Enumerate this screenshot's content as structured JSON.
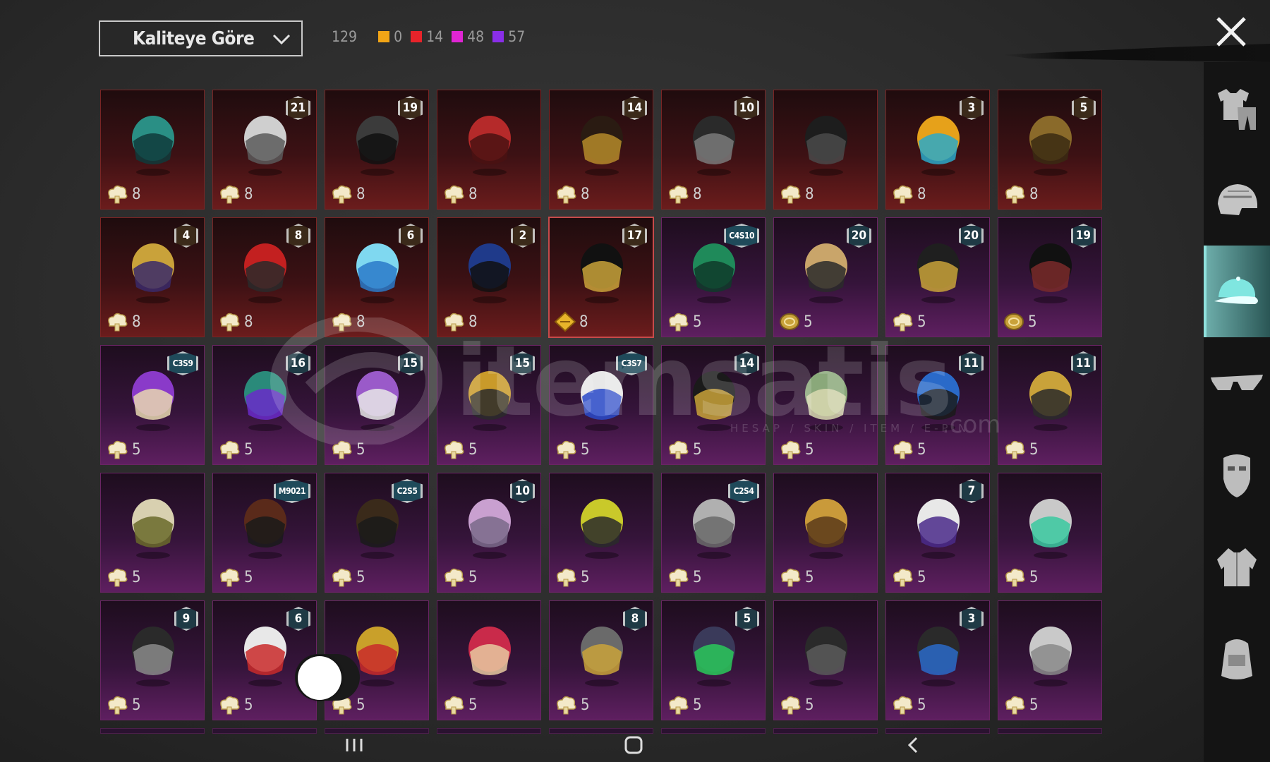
{
  "header": {
    "sort_label": "Kaliteye Göre",
    "total_count": "129",
    "rarity_counts": [
      {
        "color": "#f2a516",
        "count": "0"
      },
      {
        "color": "#e8232a",
        "count": "14"
      },
      {
        "color": "#e025d4",
        "count": "48"
      },
      {
        "color": "#8a2ee8",
        "count": "57"
      }
    ]
  },
  "sidebar": {
    "items": [
      {
        "icon": "shirt-pants-icon"
      },
      {
        "icon": "helmet-icon"
      },
      {
        "icon": "cap-icon",
        "active": true
      },
      {
        "icon": "glasses-icon"
      },
      {
        "icon": "mask-icon"
      },
      {
        "icon": "jacket-icon"
      },
      {
        "icon": "backpack-icon"
      }
    ]
  },
  "items": [
    {
      "tier": "red",
      "badge": "",
      "cost": "8",
      "currency": "cloud"
    },
    {
      "tier": "red",
      "badge": "21",
      "cost": "8",
      "currency": "cloud"
    },
    {
      "tier": "red",
      "badge": "19",
      "cost": "8",
      "currency": "cloud"
    },
    {
      "tier": "red",
      "badge": "",
      "cost": "8",
      "currency": "cloud"
    },
    {
      "tier": "red",
      "badge": "14",
      "cost": "8",
      "currency": "cloud"
    },
    {
      "tier": "red",
      "badge": "10",
      "cost": "8",
      "currency": "cloud"
    },
    {
      "tier": "red",
      "badge": "",
      "cost": "8",
      "currency": "cloud"
    },
    {
      "tier": "red",
      "badge": "3",
      "cost": "8",
      "currency": "cloud"
    },
    {
      "tier": "red",
      "badge": "5",
      "cost": "8",
      "currency": "cloud"
    },
    {
      "tier": "red",
      "badge": "4",
      "cost": "8",
      "currency": "cloud"
    },
    {
      "tier": "red",
      "badge": "8",
      "cost": "8",
      "currency": "cloud"
    },
    {
      "tier": "red",
      "badge": "6",
      "cost": "8",
      "currency": "cloud"
    },
    {
      "tier": "red",
      "badge": "2",
      "cost": "8",
      "currency": "cloud"
    },
    {
      "tier": "red",
      "badge": "17",
      "cost": "8",
      "currency": "diamond",
      "selected": true
    },
    {
      "tier": "purple",
      "badge": "C4S10",
      "cost": "5",
      "currency": "cloud"
    },
    {
      "tier": "purple",
      "badge": "20",
      "cost": "5",
      "currency": "coin"
    },
    {
      "tier": "purple",
      "badge": "20",
      "cost": "5",
      "currency": "cloud"
    },
    {
      "tier": "purple",
      "badge": "19",
      "cost": "5",
      "currency": "coin"
    },
    {
      "tier": "purple",
      "badge": "C3S9",
      "cost": "5",
      "currency": "cloud"
    },
    {
      "tier": "purple",
      "badge": "16",
      "cost": "5",
      "currency": "cloud"
    },
    {
      "tier": "purple",
      "badge": "15",
      "cost": "5",
      "currency": "cloud"
    },
    {
      "tier": "purple",
      "badge": "15",
      "cost": "5",
      "currency": "cloud"
    },
    {
      "tier": "purple",
      "badge": "C3S7",
      "cost": "5",
      "currency": "cloud"
    },
    {
      "tier": "purple",
      "badge": "14",
      "cost": "5",
      "currency": "cloud"
    },
    {
      "tier": "purple",
      "badge": "",
      "cost": "5",
      "currency": "cloud"
    },
    {
      "tier": "purple",
      "badge": "11",
      "cost": "5",
      "currency": "cloud"
    },
    {
      "tier": "purple",
      "badge": "11",
      "cost": "5",
      "currency": "cloud"
    },
    {
      "tier": "purple",
      "badge": "",
      "cost": "5",
      "currency": "cloud"
    },
    {
      "tier": "purple",
      "badge": "M9021",
      "cost": "5",
      "currency": "cloud"
    },
    {
      "tier": "purple",
      "badge": "C2S5",
      "cost": "5",
      "currency": "cloud"
    },
    {
      "tier": "purple",
      "badge": "10",
      "cost": "5",
      "currency": "cloud"
    },
    {
      "tier": "purple",
      "badge": "",
      "cost": "5",
      "currency": "cloud"
    },
    {
      "tier": "purple",
      "badge": "C2S4",
      "cost": "5",
      "currency": "cloud"
    },
    {
      "tier": "purple",
      "badge": "",
      "cost": "5",
      "currency": "cloud"
    },
    {
      "tier": "purple",
      "badge": "7",
      "cost": "5",
      "currency": "cloud"
    },
    {
      "tier": "purple",
      "badge": "",
      "cost": "5",
      "currency": "cloud"
    },
    {
      "tier": "purple",
      "badge": "9",
      "cost": "5",
      "currency": "cloud"
    },
    {
      "tier": "purple",
      "badge": "6",
      "cost": "5",
      "currency": "cloud"
    },
    {
      "tier": "purple",
      "badge": "",
      "cost": "5",
      "currency": "cloud"
    },
    {
      "tier": "purple",
      "badge": "",
      "cost": "5",
      "currency": "cloud"
    },
    {
      "tier": "purple",
      "badge": "8",
      "cost": "5",
      "currency": "cloud"
    },
    {
      "tier": "purple",
      "badge": "5",
      "cost": "5",
      "currency": "cloud"
    },
    {
      "tier": "purple",
      "badge": "",
      "cost": "5",
      "currency": "cloud"
    },
    {
      "tier": "purple",
      "badge": "3",
      "cost": "5",
      "currency": "cloud"
    },
    {
      "tier": "purple",
      "badge": "",
      "cost": "5",
      "currency": "cloud"
    }
  ],
  "watermark": {
    "brand": "itemsatis",
    "tagline": "HESAP / SKIN / ITEM / E-PIN",
    "suffix": ".com"
  },
  "navbar": {
    "icons": [
      "recent-apps-icon",
      "home-icon",
      "back-icon"
    ]
  }
}
